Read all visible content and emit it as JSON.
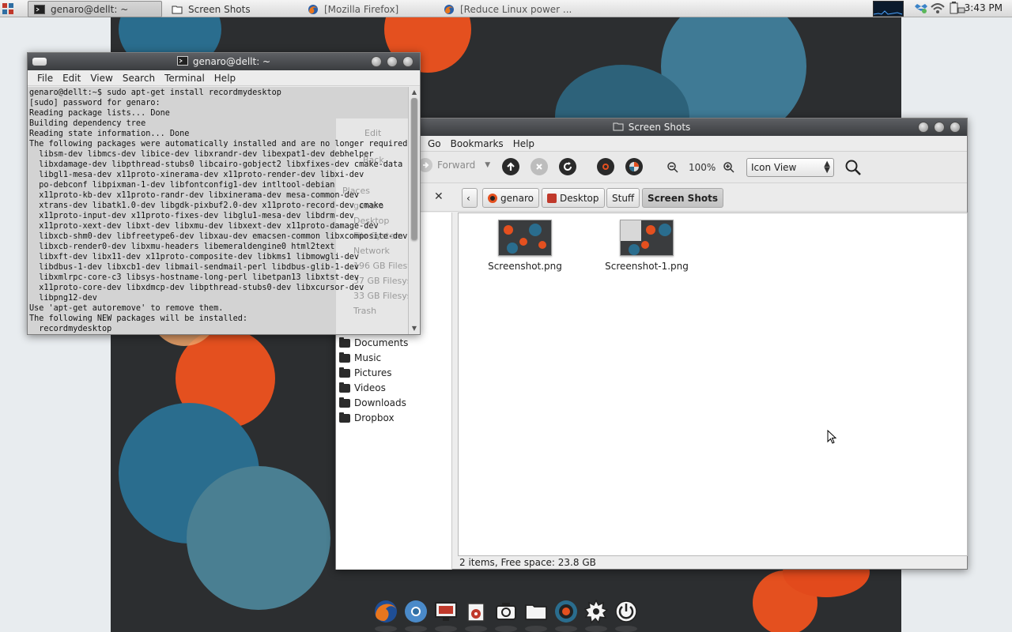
{
  "panel": {
    "tasks": [
      {
        "label": "genaro@dellt: ~",
        "active": true
      },
      {
        "label": "Screen Shots",
        "active": false
      },
      {
        "label": "[Mozilla Firefox]",
        "active": false
      },
      {
        "label": "[Reduce Linux power ...",
        "active": false
      }
    ],
    "clock": "3:43 PM"
  },
  "terminal": {
    "title": "genaro@dellt: ~",
    "menu": [
      "File",
      "Edit",
      "View",
      "Search",
      "Terminal",
      "Help"
    ],
    "lines": [
      "genaro@dellt:~$ sudo apt-get install recordmydesktop",
      "[sudo] password for genaro:",
      "Reading package lists... Done",
      "Building dependency tree",
      "Reading state information... Done",
      "The following packages were automatically installed and are no longer required:",
      "  libsm-dev libmcs-dev libice-dev libxrandr-dev libexpat1-dev debhelper",
      "  libxdamage-dev libpthread-stubs0 libcairo-gobject2 libxfixes-dev cmake-data",
      "  libgl1-mesa-dev x11proto-xinerama-dev x11proto-render-dev libxi-dev",
      "  po-debconf libpixman-1-dev libfontconfig1-dev intltool-debian",
      "  x11proto-kb-dev x11proto-randr-dev libxinerama-dev mesa-common-dev",
      "  xtrans-dev libatk1.0-dev libgdk-pixbuf2.0-dev x11proto-record-dev cmake",
      "  x11proto-input-dev x11proto-fixes-dev libglu1-mesa-dev libdrm-dev",
      "  x11proto-xext-dev libxt-dev libxmu-dev libxext-dev x11proto-damage-dev",
      "  libxcb-shm0-dev libfreetype6-dev libxau-dev emacsen-common libxcomposite-dev",
      "  libxcb-render0-dev libxmu-headers libemeraldengine0 html2text",
      "  libxft-dev libx11-dev x11proto-composite-dev libkms1 libmowgli-dev",
      "  libdbus-1-dev libxcb1-dev libmail-sendmail-perl libdbus-glib-1-dev",
      "  libxmlrpc-core-c3 libsys-hostname-long-perl libetpan13 libxtst-dev",
      "  x11proto-core-dev libxdmcp-dev libpthread-stubs0-dev libxcursor-dev",
      "  libpng12-dev",
      "Use 'apt-get autoremove' to remove them.",
      "The following NEW packages will be installed:",
      "  recordmydesktop"
    ]
  },
  "filemanager": {
    "title": "Screen Shots",
    "menu": [
      "Go",
      "Bookmarks",
      "Help"
    ],
    "toolbar": {
      "forward": "Forward",
      "zoom": "100%",
      "view": "Icon View"
    },
    "path": [
      "genaro",
      "Desktop",
      "Stuff",
      "Screen Shots"
    ],
    "ghost_sidebar": [
      "Places",
      "genaro",
      "Desktop",
      "File System",
      "Network",
      "196 GB Filesystem",
      "37 GB Filesystem",
      "33 GB Filesystem",
      "Trash"
    ],
    "ghost_toolbar": [
      "Edit",
      "Back"
    ],
    "sidebar": [
      "Documents",
      "Music",
      "Pictures",
      "Videos",
      "Downloads",
      "Dropbox"
    ],
    "files": [
      {
        "name": "Screenshot.png"
      },
      {
        "name": "Screenshot-1.png"
      }
    ],
    "status": "2 items, Free space: 23.8 GB"
  },
  "dock": [
    "firefox-icon",
    "chromium-icon",
    "monitor-icon",
    "media-player-icon",
    "camera-icon",
    "folder-icon",
    "record-icon",
    "settings-gear-icon",
    "power-icon"
  ],
  "colors": {
    "orange": "#e4501f",
    "blue": "#2a6d8e",
    "panel": "#dcdcdc",
    "titlebar": "#45474a"
  }
}
